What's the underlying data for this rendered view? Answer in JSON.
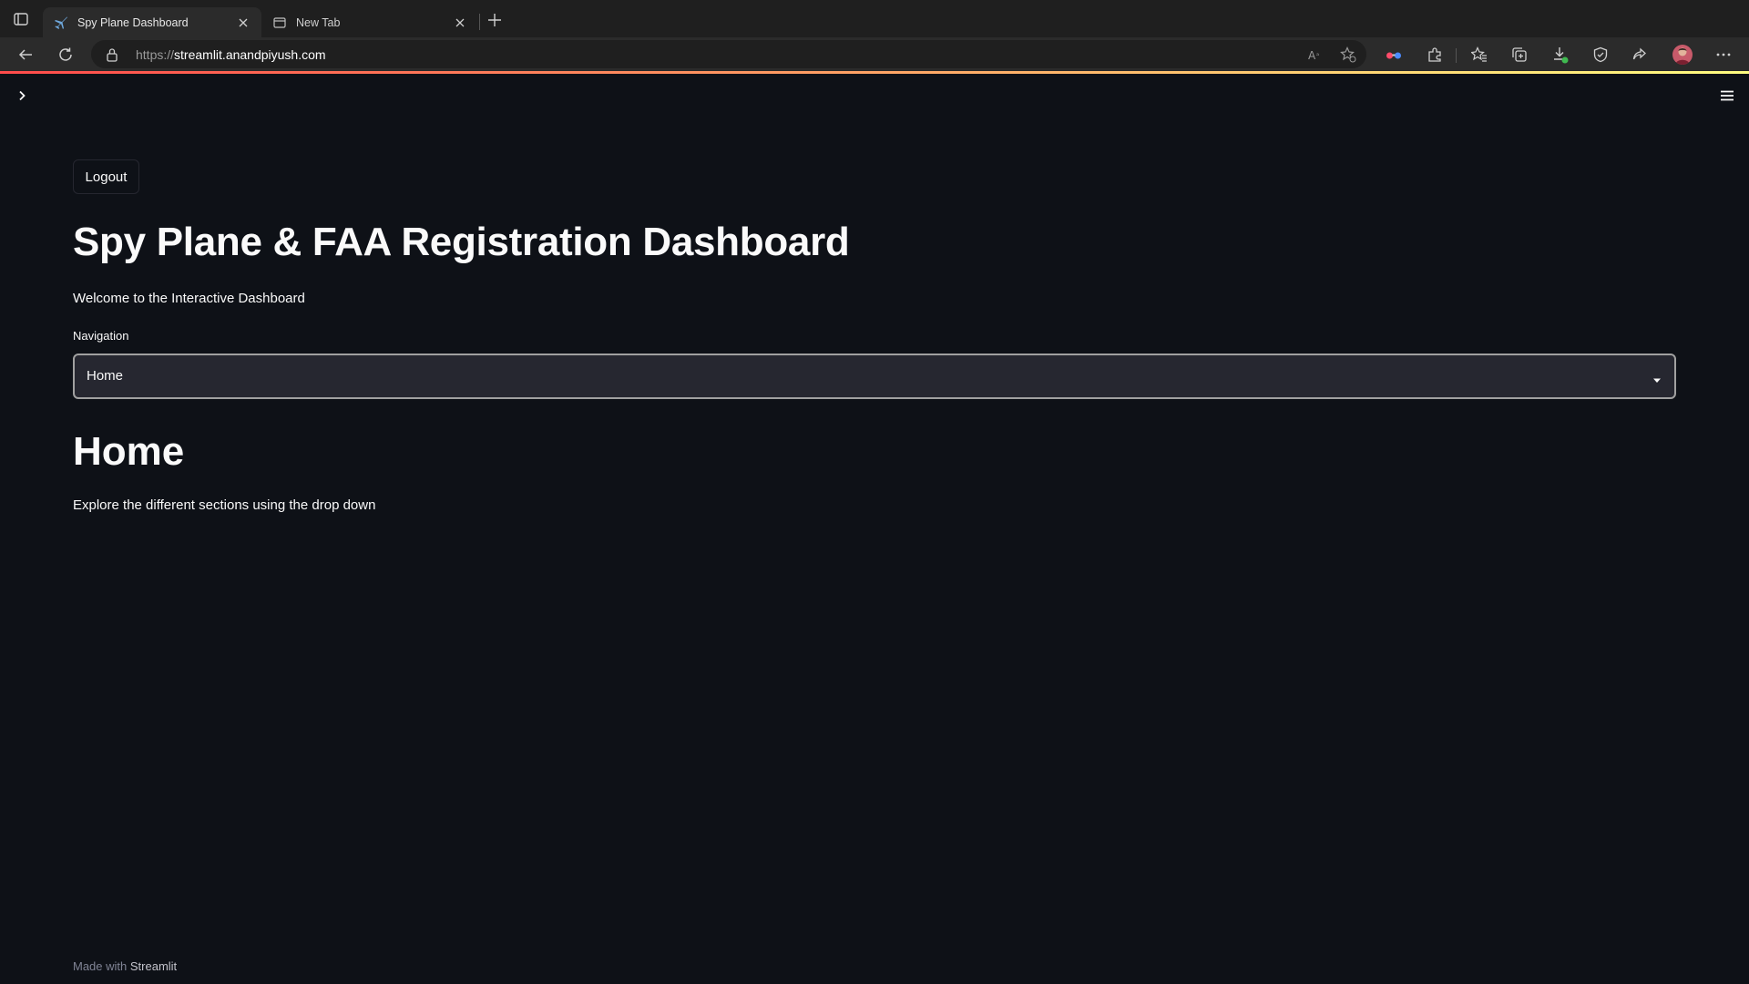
{
  "browser": {
    "tabs": [
      {
        "title": "Spy Plane Dashboard",
        "favicon": "airplane-icon",
        "active": true
      },
      {
        "title": "New Tab",
        "favicon": "newtab-icon",
        "active": false
      }
    ],
    "url": {
      "scheme": "https://",
      "host": "streamlit.anandpiyush.com"
    },
    "accent_gradient": [
      "#ff4b4b",
      "#fffd80"
    ]
  },
  "app": {
    "logout_label": "Logout",
    "title": "Spy Plane & FAA Registration Dashboard",
    "welcome": "Welcome to the Interactive Dashboard",
    "navigation": {
      "label": "Navigation",
      "selected": "Home"
    },
    "section_title": "Home",
    "section_text": "Explore the different sections using the drop down",
    "footer": {
      "prefix": "Made with ",
      "brand": "Streamlit"
    }
  },
  "colors": {
    "background": "#0e1117",
    "text": "#fafafa",
    "select_bg": "#262730"
  }
}
